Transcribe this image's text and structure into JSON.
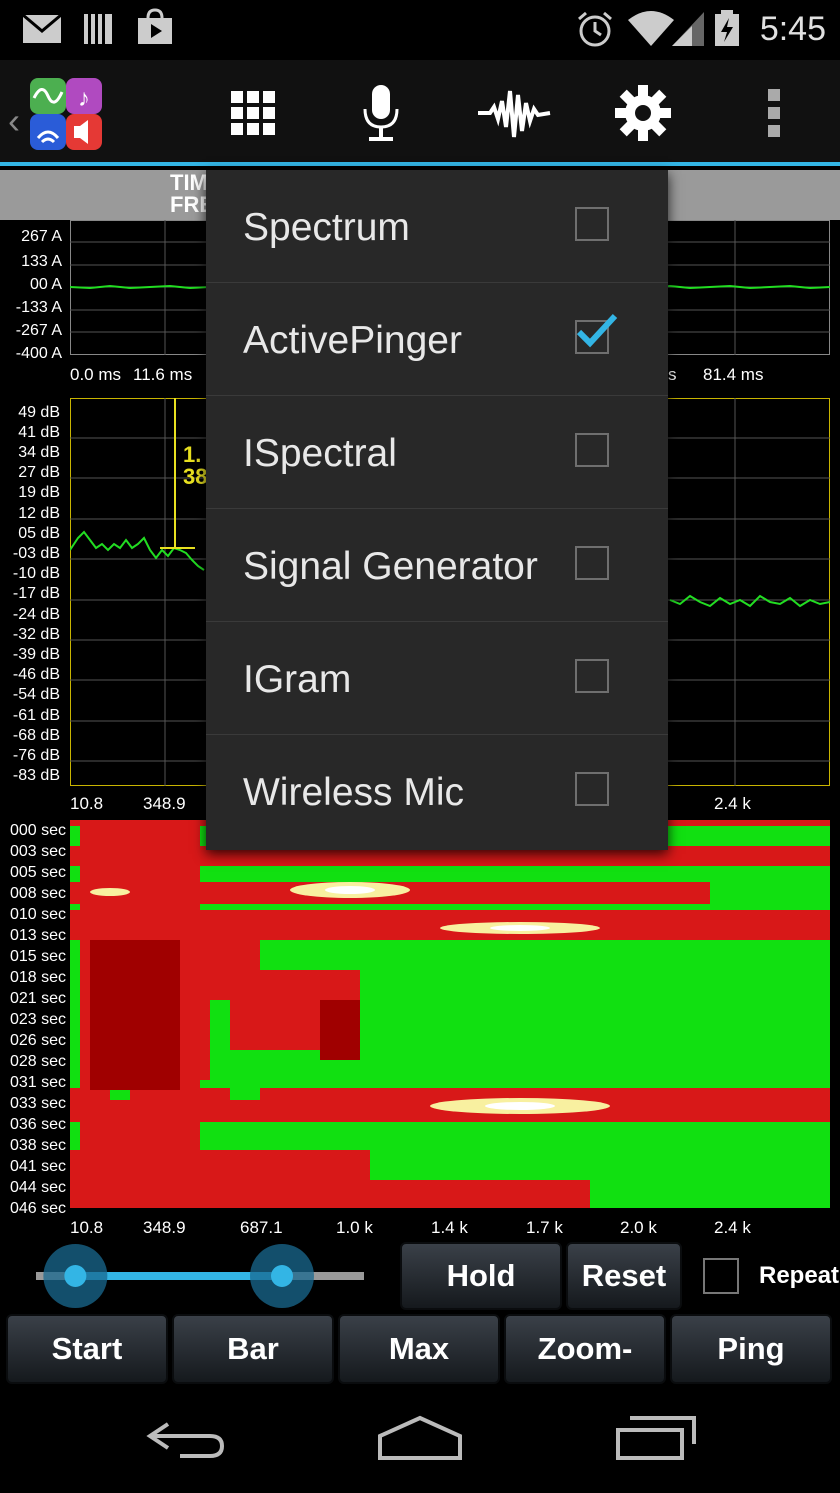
{
  "status_bar": {
    "time": "5:45",
    "icons": [
      "email-icon",
      "storage-icon",
      "store-icon",
      "alarm-icon",
      "wifi-icon",
      "signal-icon",
      "battery-icon"
    ]
  },
  "action_bar": {
    "icons": [
      "app-logo-icon",
      "grid-icon",
      "microphone-icon",
      "waveform-icon",
      "settings-icon",
      "overflow-menu-icon"
    ]
  },
  "tab": {
    "line1": "TIM",
    "line2": "FRE"
  },
  "time_plot": {
    "y_labels": [
      "267 A",
      "133 A",
      "00 A",
      "-133 A",
      "-267 A",
      "-400 A"
    ],
    "x_labels": [
      "0.0 ms",
      "11.6 ms",
      "s",
      "81.4 ms"
    ]
  },
  "spectrum_plot": {
    "y_labels": [
      "49 dB",
      "41 dB",
      "34 dB",
      "27 dB",
      "19 dB",
      "12 dB",
      "05 dB",
      "-03 dB",
      "-10 dB",
      "-17 dB",
      "-24 dB",
      "-32 dB",
      "-39 dB",
      "-46 dB",
      "-54 dB",
      "-61 dB",
      "-68 dB",
      "-76 dB",
      "-83 dB"
    ],
    "x_labels": [
      "10.8",
      "348.9",
      "2.4 k"
    ],
    "cursor_text": [
      "1.",
      "38"
    ]
  },
  "spectrogram": {
    "y_labels": [
      "000 sec",
      "003 sec",
      "005 sec",
      "008 sec",
      "010 sec",
      "013 sec",
      "015 sec",
      "018 sec",
      "021 sec",
      "023 sec",
      "026 sec",
      "028 sec",
      "031 sec",
      "033 sec",
      "036 sec",
      "038 sec",
      "041 sec",
      "044 sec",
      "046 sec"
    ],
    "x_labels": [
      "10.8",
      "348.9",
      "687.1",
      "1.0 k",
      "1.4 k",
      "1.7 k",
      "2.0 k",
      "2.4 k"
    ]
  },
  "menu": {
    "items": [
      {
        "label": "Spectrum",
        "checked": false
      },
      {
        "label": "ActivePinger",
        "checked": true
      },
      {
        "label": "ISpectral",
        "checked": false
      },
      {
        "label": "Signal Generator",
        "checked": false
      },
      {
        "label": "IGram",
        "checked": false
      },
      {
        "label": "Wireless Mic",
        "checked": false
      }
    ]
  },
  "controls": {
    "hold": "Hold",
    "reset": "Reset",
    "repeat": "Repeat",
    "repeat_checked": false,
    "range_slider": {
      "low": 0.12,
      "high": 0.75
    },
    "buttons": [
      "Start",
      "Bar",
      "Max",
      "Zoom-",
      "Ping"
    ]
  },
  "nav_bar": {
    "icons": [
      "back-icon",
      "home-icon",
      "recent-apps-icon"
    ]
  },
  "colors": {
    "accent": "#33b5e5",
    "trace": "#22dd22",
    "cursor": "#e8e020"
  }
}
